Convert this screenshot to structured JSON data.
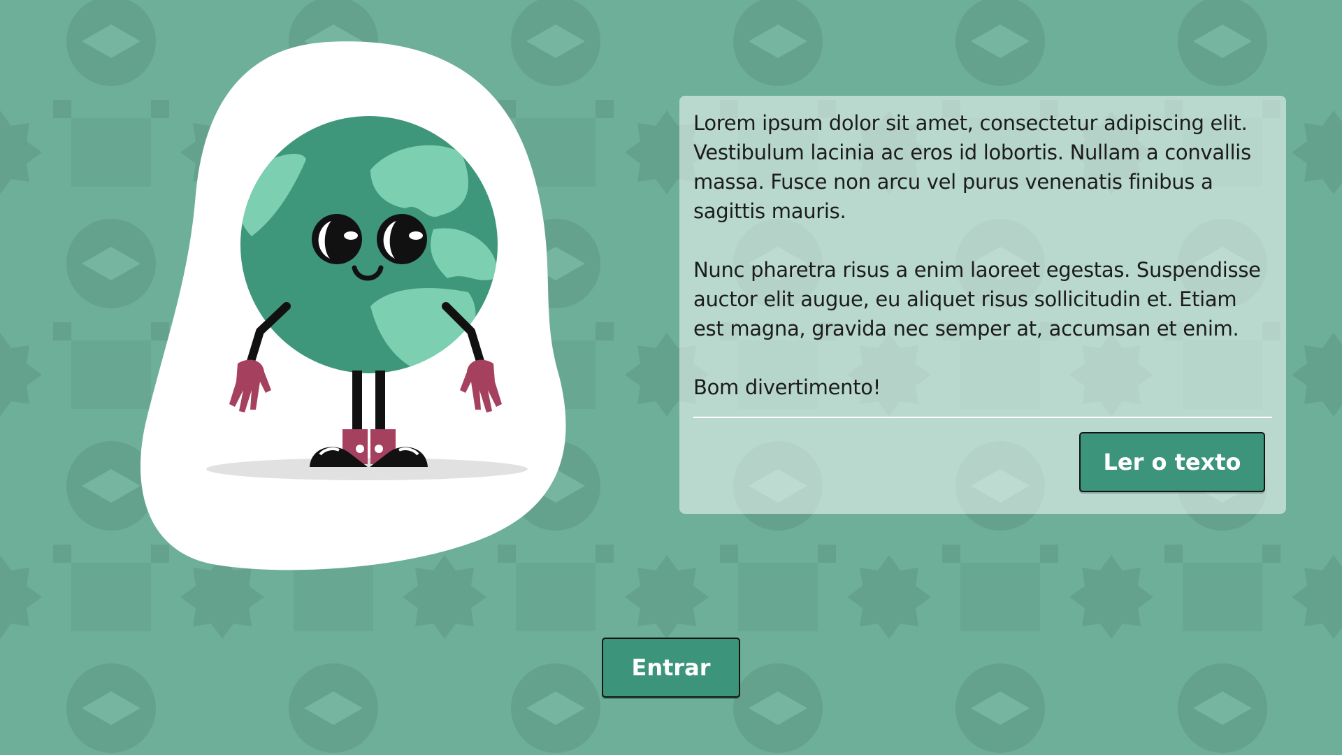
{
  "text_panel": {
    "paragraphs": [
      "Lorem ipsum dolor sit amet, consectetur adipiscing elit. Vestibulum lacinia ac eros id lobortis. Nullam a convallis massa. Fusce non arcu vel purus venenatis finibus a sagittis mauris.",
      "Nunc pharetra risus a enim laoreet egestas. Suspendisse auctor elit augue, eu aliquet risus sollicitudin et. Etiam est magna, gravida nec semper at, accumsan et enim.",
      "Bom divertimento!"
    ],
    "read_button_label": "Ler o texto"
  },
  "enter_button_label": "Entrar",
  "colors": {
    "background": "#6daf98",
    "accent": "#3c957a",
    "globe": "#3f977b",
    "land": "#7ccfb1",
    "hands": "#a5405e"
  },
  "mascot": {
    "description_icon": "globe-mascot-icon"
  }
}
